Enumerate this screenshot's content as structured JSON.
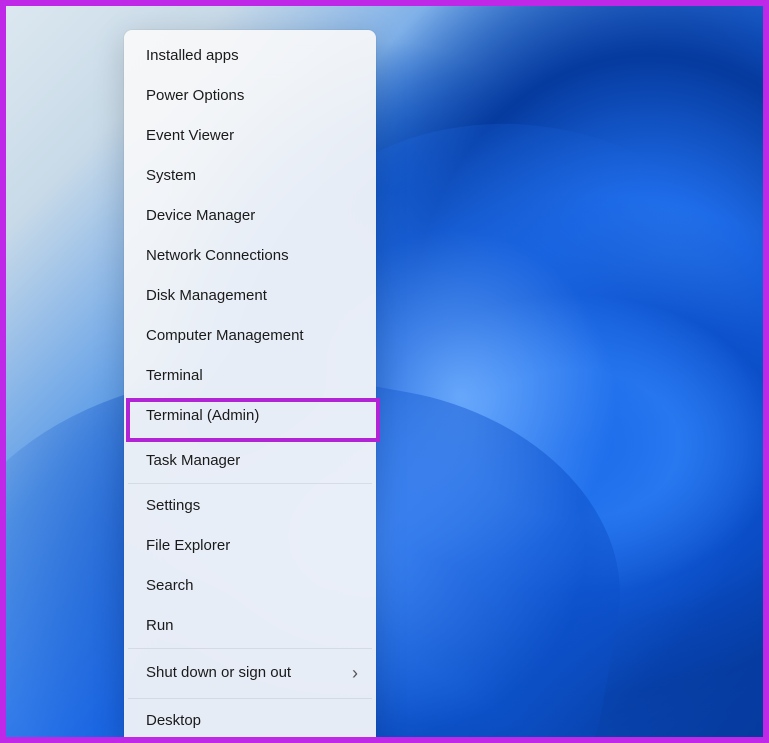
{
  "menu": {
    "items": [
      {
        "label": "Installed apps",
        "name": "menu-item-installed-apps",
        "hasSubmenu": false
      },
      {
        "label": "Power Options",
        "name": "menu-item-power-options",
        "hasSubmenu": false
      },
      {
        "label": "Event Viewer",
        "name": "menu-item-event-viewer",
        "hasSubmenu": false
      },
      {
        "label": "System",
        "name": "menu-item-system",
        "hasSubmenu": false
      },
      {
        "label": "Device Manager",
        "name": "menu-item-device-manager",
        "hasSubmenu": false
      },
      {
        "label": "Network Connections",
        "name": "menu-item-network-connections",
        "hasSubmenu": false
      },
      {
        "label": "Disk Management",
        "name": "menu-item-disk-management",
        "hasSubmenu": false
      },
      {
        "label": "Computer Management",
        "name": "menu-item-computer-management",
        "hasSubmenu": false
      },
      {
        "label": "Terminal",
        "name": "menu-item-terminal",
        "hasSubmenu": false
      },
      {
        "label": "Terminal (Admin)",
        "name": "menu-item-terminal-admin",
        "hasSubmenu": false,
        "highlighted": true
      },
      {
        "label": "Task Manager",
        "name": "menu-item-task-manager",
        "hasSubmenu": false
      },
      {
        "label": "Settings",
        "name": "menu-item-settings",
        "hasSubmenu": false
      },
      {
        "label": "File Explorer",
        "name": "menu-item-file-explorer",
        "hasSubmenu": false
      },
      {
        "label": "Search",
        "name": "menu-item-search",
        "hasSubmenu": false
      },
      {
        "label": "Run",
        "name": "menu-item-run",
        "hasSubmenu": false
      },
      {
        "label": "Shut down or sign out",
        "name": "menu-item-shutdown",
        "hasSubmenu": true
      },
      {
        "label": "Desktop",
        "name": "menu-item-desktop",
        "hasSubmenu": false
      }
    ],
    "separatorAfter": [
      9,
      10,
      14,
      15
    ]
  },
  "colors": {
    "highlightBorder": "#b024d6",
    "outerBorder": "#c028e8"
  }
}
